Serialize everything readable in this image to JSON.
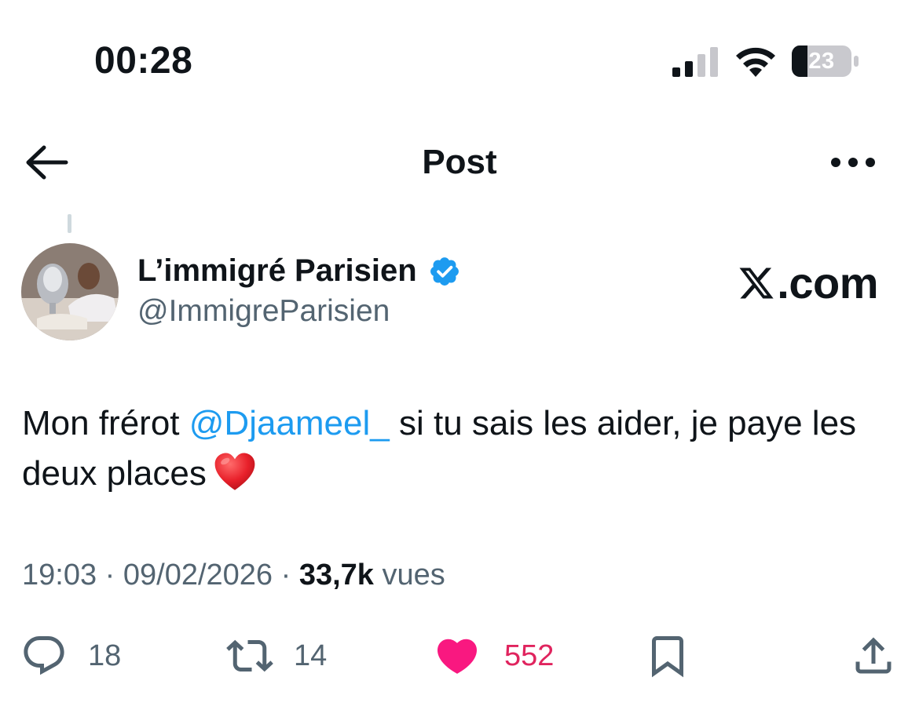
{
  "status_bar": {
    "time": "00:28",
    "battery_level": "23",
    "icons": [
      "cellular-signal-icon",
      "wifi-icon",
      "battery-icon"
    ]
  },
  "nav": {
    "title": "Post",
    "icons": [
      "back-arrow-icon",
      "more-options-icon"
    ]
  },
  "author": {
    "display_name": "L’immigré Parisien",
    "handle": "@ImmigreParisien",
    "verified": true
  },
  "brand": {
    "text": ".com",
    "icon": "x-logo-icon"
  },
  "tweet": {
    "text_before_mention": "Mon frérot ",
    "mention": "@Djaameel_",
    "text_after_mention": " si tu sais les aider, je paye les deux places",
    "emoji": "red-heart-emoji"
  },
  "meta": {
    "time": "19:03",
    "separator": " · ",
    "date": "09/02/2026",
    "views_count": "33,7k",
    "views_label": " vues"
  },
  "actions": {
    "replies": "18",
    "retweets": "14",
    "likes": "552"
  },
  "colors": {
    "accent": "#1d9bf0",
    "like": "#f91880",
    "secondary_text": "#536471",
    "primary_text": "#0f1419"
  }
}
